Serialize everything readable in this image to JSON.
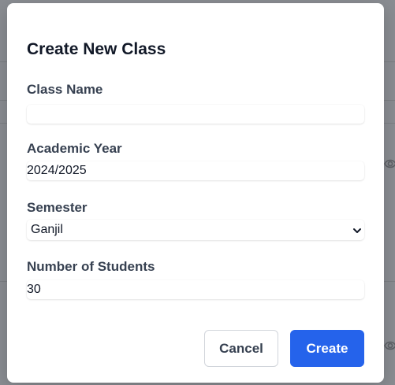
{
  "modal": {
    "title": "Create New Class",
    "fields": {
      "class_name": {
        "label": "Class Name",
        "value": "",
        "placeholder": ""
      },
      "academic_year": {
        "label": "Academic Year",
        "value": "2024/2025"
      },
      "semester": {
        "label": "Semester",
        "selected": "Ganjil"
      },
      "students": {
        "label": "Number of Students",
        "value": "30"
      }
    },
    "buttons": {
      "cancel": "Cancel",
      "create": "Create"
    }
  },
  "colors": {
    "primary": "#2563eb",
    "overlay": "#8a8d92"
  },
  "icons": {
    "background_view": "eye-icon",
    "select_arrow": "chevron-down-icon"
  }
}
